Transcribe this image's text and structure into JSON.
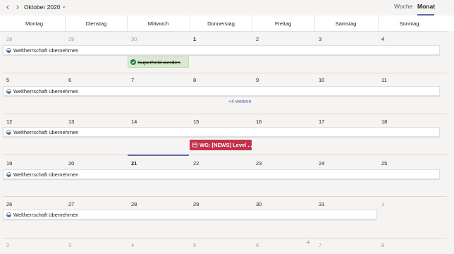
{
  "header": {
    "month_label": "Oktober 2020",
    "view_week": "Woche",
    "view_month": "Monat"
  },
  "days": [
    "Montag",
    "Dienstag",
    "Mittwoch",
    "Donnerstag",
    "Freitag",
    "Samstag",
    "Sonntag"
  ],
  "weeks": [
    [
      "28",
      "29",
      "30",
      "1",
      "2",
      "3",
      "4"
    ],
    [
      "5",
      "6",
      "7",
      "8",
      "9",
      "10",
      "11"
    ],
    [
      "12",
      "13",
      "14",
      "15",
      "16",
      "17",
      "18"
    ],
    [
      "19",
      "20",
      "21",
      "22",
      "23",
      "24",
      "25"
    ],
    [
      "26",
      "27",
      "28",
      "29",
      "30",
      "31",
      "1"
    ],
    [
      "2",
      "3",
      "4",
      "5",
      "6",
      "7",
      "8"
    ]
  ],
  "events": {
    "recurring": "Weltherrschaft übernehmen",
    "completed": "Superheld werden",
    "red": "WG: [NEWS] Level ...",
    "more": "+4 weitere"
  },
  "colors": {
    "accent": "#6264a7",
    "event_red": "#c4314b",
    "completed_bg": "#d8ebd1"
  },
  "icons": [
    "chevron-left-icon",
    "chevron-right-icon",
    "chevron-down-icon",
    "half-circle-icon",
    "check-circle-icon",
    "calendar-event-icon",
    "plus-icon"
  ]
}
